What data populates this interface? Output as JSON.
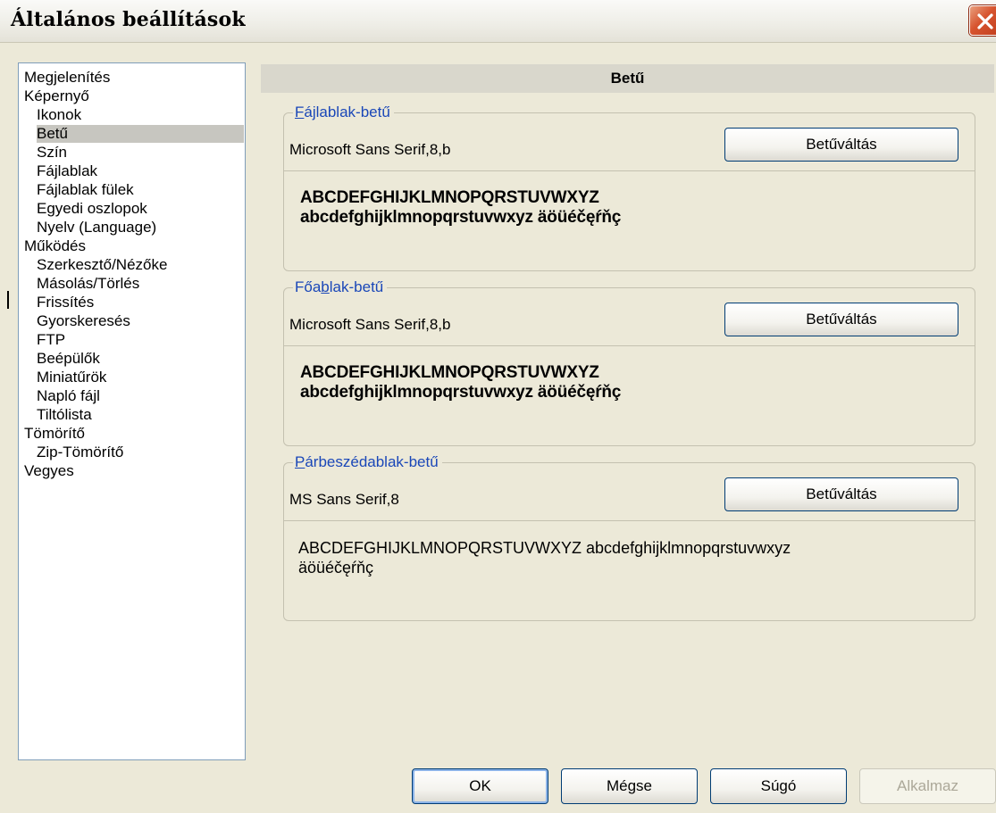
{
  "window": {
    "title": "Általános beállítások",
    "close_icon": "close-icon"
  },
  "tree": {
    "items": [
      {
        "label": "Megjelenítés"
      },
      {
        "label": "Képernyő"
      },
      {
        "label": "Ikonok"
      },
      {
        "label": "Betű"
      },
      {
        "label": "Szín"
      },
      {
        "label": "Fájlablak"
      },
      {
        "label": "Fájlablak fülek"
      },
      {
        "label": "Egyedi oszlopok"
      },
      {
        "label": "Nyelv (Language)"
      },
      {
        "label": "Működés"
      },
      {
        "label": "Szerkesztő/Nézőke"
      },
      {
        "label": "Másolás/Törlés"
      },
      {
        "label": "Frissítés"
      },
      {
        "label": "Gyorskeresés"
      },
      {
        "label": "FTP"
      },
      {
        "label": "Beépülők"
      },
      {
        "label": "Miniatűrök"
      },
      {
        "label": "Napló fájl"
      },
      {
        "label": "Tiltólista"
      },
      {
        "label": "Tömörítő"
      },
      {
        "label": "Zip-Tömörítő"
      },
      {
        "label": "Vegyes"
      }
    ],
    "selected": "Betű"
  },
  "panel": {
    "header": "Betű",
    "groups": [
      {
        "legend_pre": "",
        "legend_ul": "F",
        "legend_post": "ájlablak-betű",
        "font_name": "Microsoft Sans Serif,8,b",
        "button_label": "Betűváltás",
        "sample_line1": "ABCDEFGHIJKLMNOPQRSTUVWXYZ",
        "sample_line2": "abcdefghijklmnopqrstuvwxyz äöüéčęŕňç"
      },
      {
        "legend_pre": "Főa",
        "legend_ul": "b",
        "legend_post": "lak-betű",
        "font_name": "Microsoft Sans Serif,8,b",
        "button_label": "Betűváltás",
        "sample_line1": "ABCDEFGHIJKLMNOPQRSTUVWXYZ",
        "sample_line2": "abcdefghijklmnopqrstuvwxyz äöüéčęŕňç"
      },
      {
        "legend_pre": "",
        "legend_ul": "P",
        "legend_post": "árbeszédablak-betű",
        "font_name": "MS Sans Serif,8",
        "button_label": "Betűváltás",
        "sample_line1": "ABCDEFGHIJKLMNOPQRSTUVWXYZ abcdefghijklmnopqrstuvwxyz",
        "sample_line2": "äöüéčęŕňç"
      }
    ]
  },
  "buttons": {
    "ok": "OK",
    "cancel": "Mégse",
    "help": "Súgó",
    "apply": "Alkalmaz"
  },
  "colors": {
    "accent": "#1a47b8",
    "selection": "#c7c6c0",
    "window_bg": "#ece9d8"
  }
}
